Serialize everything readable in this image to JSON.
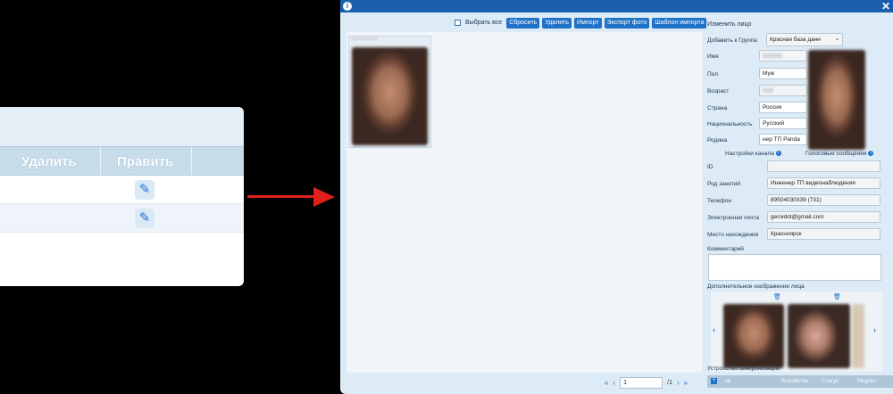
{
  "zoom": {
    "col_delete": "Удалить",
    "col_edit": "Править"
  },
  "dialog": {
    "toolbar": {
      "select_all": "Выбрать все",
      "reset": "Сбросить",
      "delete": "Удалить",
      "import": "Импорт",
      "export_photo": "Экспорт фото",
      "import_template": "Шаблон импорта"
    },
    "pager": {
      "page": "1",
      "total": "/1"
    }
  },
  "panel": {
    "title": "Изменить лицо",
    "add_to_group_label": "Добавить к Группа",
    "group_value": "Красная база данн",
    "name_label": "Имя",
    "gender_label": "Пол",
    "gender_value": "Муж",
    "age_label": "Возраст",
    "country_label": "Страна",
    "country_value": "Россия",
    "nationality_label": "Национальность",
    "nationality_value": "Русский",
    "homeland_label": "Родина",
    "homeland_value": "нер ТП Panda",
    "channel_settings": "Настройки канала",
    "voice_messages": "Голосовые сообщения",
    "id_label": "ID",
    "occupation_label": "Род занятий",
    "occupation_value": "Инженер ТП видеонаблюдения",
    "phone_label": "Телефон",
    "phone_value": "89504030339 (731)",
    "email_label": "Электронная почта",
    "email_value": "geroidot@gmail.com",
    "location_label": "Место нахождения",
    "location_value": "Красноярск",
    "comment_label": "Комментарий",
    "extra_image_label": "Дополнительное изображение лица",
    "sync_label": "Устройство синхронизации",
    "sync_cols": [
      "№",
      "Устройство",
      "Статус",
      "Результ"
    ]
  }
}
